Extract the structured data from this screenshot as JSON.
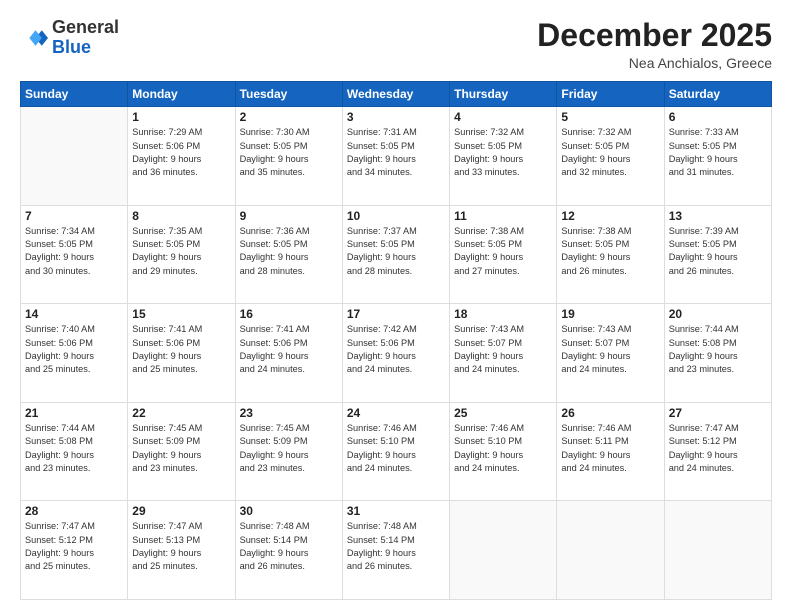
{
  "header": {
    "logo_general": "General",
    "logo_blue": "Blue",
    "month_title": "December 2025",
    "location": "Nea Anchialos, Greece"
  },
  "weekdays": [
    "Sunday",
    "Monday",
    "Tuesday",
    "Wednesday",
    "Thursday",
    "Friday",
    "Saturday"
  ],
  "weeks": [
    [
      {
        "day": "",
        "info": ""
      },
      {
        "day": "1",
        "info": "Sunrise: 7:29 AM\nSunset: 5:06 PM\nDaylight: 9 hours\nand 36 minutes."
      },
      {
        "day": "2",
        "info": "Sunrise: 7:30 AM\nSunset: 5:05 PM\nDaylight: 9 hours\nand 35 minutes."
      },
      {
        "day": "3",
        "info": "Sunrise: 7:31 AM\nSunset: 5:05 PM\nDaylight: 9 hours\nand 34 minutes."
      },
      {
        "day": "4",
        "info": "Sunrise: 7:32 AM\nSunset: 5:05 PM\nDaylight: 9 hours\nand 33 minutes."
      },
      {
        "day": "5",
        "info": "Sunrise: 7:32 AM\nSunset: 5:05 PM\nDaylight: 9 hours\nand 32 minutes."
      },
      {
        "day": "6",
        "info": "Sunrise: 7:33 AM\nSunset: 5:05 PM\nDaylight: 9 hours\nand 31 minutes."
      }
    ],
    [
      {
        "day": "7",
        "info": "Sunrise: 7:34 AM\nSunset: 5:05 PM\nDaylight: 9 hours\nand 30 minutes."
      },
      {
        "day": "8",
        "info": "Sunrise: 7:35 AM\nSunset: 5:05 PM\nDaylight: 9 hours\nand 29 minutes."
      },
      {
        "day": "9",
        "info": "Sunrise: 7:36 AM\nSunset: 5:05 PM\nDaylight: 9 hours\nand 28 minutes."
      },
      {
        "day": "10",
        "info": "Sunrise: 7:37 AM\nSunset: 5:05 PM\nDaylight: 9 hours\nand 28 minutes."
      },
      {
        "day": "11",
        "info": "Sunrise: 7:38 AM\nSunset: 5:05 PM\nDaylight: 9 hours\nand 27 minutes."
      },
      {
        "day": "12",
        "info": "Sunrise: 7:38 AM\nSunset: 5:05 PM\nDaylight: 9 hours\nand 26 minutes."
      },
      {
        "day": "13",
        "info": "Sunrise: 7:39 AM\nSunset: 5:05 PM\nDaylight: 9 hours\nand 26 minutes."
      }
    ],
    [
      {
        "day": "14",
        "info": "Sunrise: 7:40 AM\nSunset: 5:06 PM\nDaylight: 9 hours\nand 25 minutes."
      },
      {
        "day": "15",
        "info": "Sunrise: 7:41 AM\nSunset: 5:06 PM\nDaylight: 9 hours\nand 25 minutes."
      },
      {
        "day": "16",
        "info": "Sunrise: 7:41 AM\nSunset: 5:06 PM\nDaylight: 9 hours\nand 24 minutes."
      },
      {
        "day": "17",
        "info": "Sunrise: 7:42 AM\nSunset: 5:06 PM\nDaylight: 9 hours\nand 24 minutes."
      },
      {
        "day": "18",
        "info": "Sunrise: 7:43 AM\nSunset: 5:07 PM\nDaylight: 9 hours\nand 24 minutes."
      },
      {
        "day": "19",
        "info": "Sunrise: 7:43 AM\nSunset: 5:07 PM\nDaylight: 9 hours\nand 24 minutes."
      },
      {
        "day": "20",
        "info": "Sunrise: 7:44 AM\nSunset: 5:08 PM\nDaylight: 9 hours\nand 23 minutes."
      }
    ],
    [
      {
        "day": "21",
        "info": "Sunrise: 7:44 AM\nSunset: 5:08 PM\nDaylight: 9 hours\nand 23 minutes."
      },
      {
        "day": "22",
        "info": "Sunrise: 7:45 AM\nSunset: 5:09 PM\nDaylight: 9 hours\nand 23 minutes."
      },
      {
        "day": "23",
        "info": "Sunrise: 7:45 AM\nSunset: 5:09 PM\nDaylight: 9 hours\nand 23 minutes."
      },
      {
        "day": "24",
        "info": "Sunrise: 7:46 AM\nSunset: 5:10 PM\nDaylight: 9 hours\nand 24 minutes."
      },
      {
        "day": "25",
        "info": "Sunrise: 7:46 AM\nSunset: 5:10 PM\nDaylight: 9 hours\nand 24 minutes."
      },
      {
        "day": "26",
        "info": "Sunrise: 7:46 AM\nSunset: 5:11 PM\nDaylight: 9 hours\nand 24 minutes."
      },
      {
        "day": "27",
        "info": "Sunrise: 7:47 AM\nSunset: 5:12 PM\nDaylight: 9 hours\nand 24 minutes."
      }
    ],
    [
      {
        "day": "28",
        "info": "Sunrise: 7:47 AM\nSunset: 5:12 PM\nDaylight: 9 hours\nand 25 minutes."
      },
      {
        "day": "29",
        "info": "Sunrise: 7:47 AM\nSunset: 5:13 PM\nDaylight: 9 hours\nand 25 minutes."
      },
      {
        "day": "30",
        "info": "Sunrise: 7:48 AM\nSunset: 5:14 PM\nDaylight: 9 hours\nand 26 minutes."
      },
      {
        "day": "31",
        "info": "Sunrise: 7:48 AM\nSunset: 5:14 PM\nDaylight: 9 hours\nand 26 minutes."
      },
      {
        "day": "",
        "info": ""
      },
      {
        "day": "",
        "info": ""
      },
      {
        "day": "",
        "info": ""
      }
    ]
  ]
}
